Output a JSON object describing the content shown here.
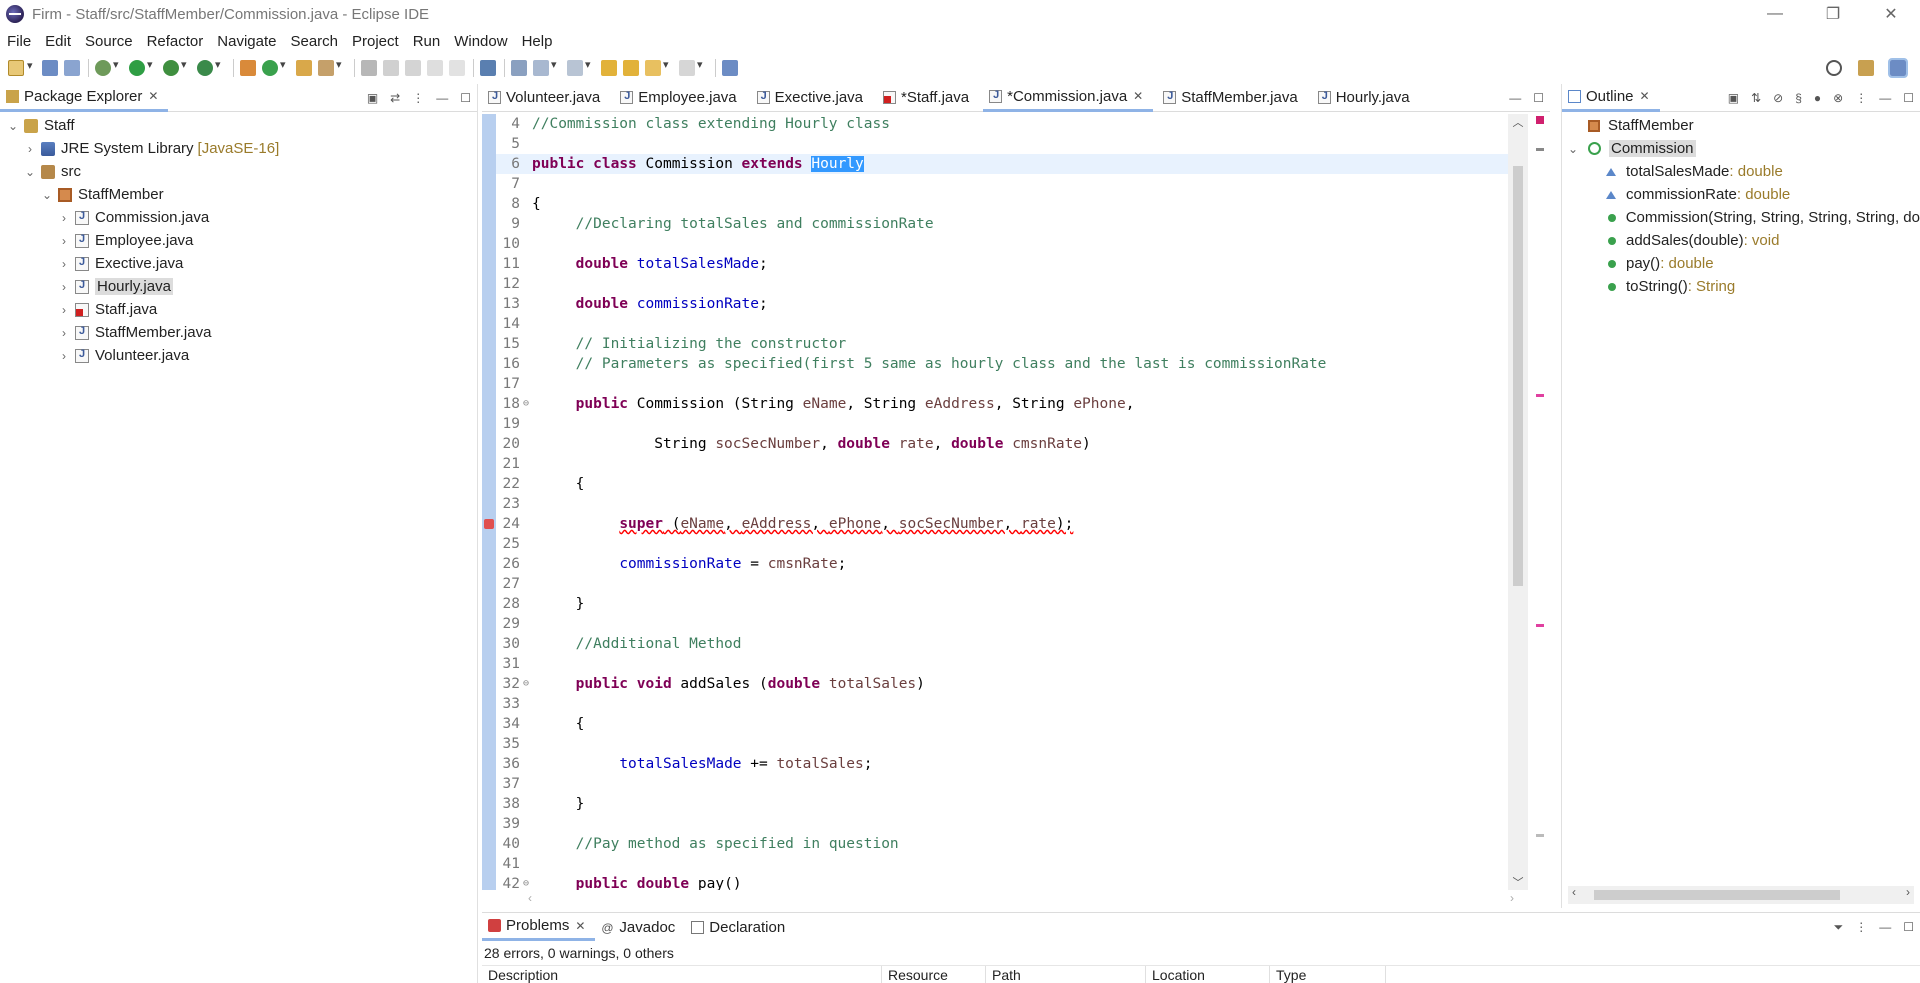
{
  "window": {
    "title": "Firm - Staff/src/StaffMember/Commission.java - Eclipse IDE",
    "controls": [
      "—",
      "❐",
      "✕"
    ]
  },
  "menu": [
    "File",
    "Edit",
    "Source",
    "Refactor",
    "Navigate",
    "Search",
    "Project",
    "Run",
    "Window",
    "Help"
  ],
  "package_explorer": {
    "tab_label": "Package Explorer",
    "tree": [
      {
        "label": "Staff",
        "twisty": "⌄",
        "indent": 0,
        "icon": "project-icon"
      },
      {
        "label": "JRE System Library",
        "decoration": "[JavaSE-16]",
        "twisty": "›",
        "indent": 1,
        "icon": "library-icon"
      },
      {
        "label": "src",
        "twisty": "⌄",
        "indent": 1,
        "icon": "source-folder-icon"
      },
      {
        "label": "StaffMember",
        "twisty": "⌄",
        "indent": 2,
        "icon": "package-icon"
      },
      {
        "label": "Commission.java",
        "twisty": "›",
        "indent": 3,
        "icon": "java-file-icon"
      },
      {
        "label": "Employee.java",
        "twisty": "›",
        "indent": 3,
        "icon": "java-file-icon"
      },
      {
        "label": "Exective.java",
        "twisty": "›",
        "indent": 3,
        "icon": "java-file-icon"
      },
      {
        "label": "Hourly.java",
        "twisty": "›",
        "indent": 3,
        "icon": "java-file-icon",
        "selected": true
      },
      {
        "label": "Staff.java",
        "twisty": "›",
        "indent": 3,
        "icon": "java-file-error-icon"
      },
      {
        "label": "StaffMember.java",
        "twisty": "›",
        "indent": 3,
        "icon": "java-file-icon"
      },
      {
        "label": "Volunteer.java",
        "twisty": "›",
        "indent": 3,
        "icon": "java-file-icon"
      }
    ]
  },
  "editor": {
    "tabs": [
      {
        "label": "Volunteer.java"
      },
      {
        "label": "Employee.java"
      },
      {
        "label": "Exective.java"
      },
      {
        "label": "*Staff.java",
        "error": true
      },
      {
        "label": "*Commission.java",
        "active": true
      },
      {
        "label": "StaffMember.java"
      },
      {
        "label": "Hourly.java"
      }
    ],
    "lines": [
      {
        "n": "4",
        "segs": [
          [
            "cm",
            "//Commission class extending Hourly class"
          ]
        ]
      },
      {
        "n": "5",
        "segs": []
      },
      {
        "n": "6",
        "hl": true,
        "segs": [
          [
            "kw",
            "public"
          ],
          [
            "",
            " "
          ],
          [
            "kw",
            "class"
          ],
          [
            "",
            " Commission "
          ],
          [
            "kw",
            "extends"
          ],
          [
            "",
            " "
          ],
          [
            "selw",
            "Hourly"
          ]
        ]
      },
      {
        "n": "7",
        "segs": []
      },
      {
        "n": "8",
        "segs": [
          [
            "",
            "{"
          ]
        ]
      },
      {
        "n": "9",
        "segs": [
          [
            "",
            "     "
          ],
          [
            "cm",
            "//Declaring totalSales and commissionRate"
          ]
        ]
      },
      {
        "n": "10",
        "segs": []
      },
      {
        "n": "11",
        "segs": [
          [
            "",
            "     "
          ],
          [
            "kw",
            "double"
          ],
          [
            "",
            " "
          ],
          [
            "fld",
            "totalSalesMade"
          ],
          [
            "",
            ";"
          ]
        ]
      },
      {
        "n": "12",
        "segs": []
      },
      {
        "n": "13",
        "segs": [
          [
            "",
            "     "
          ],
          [
            "kw",
            "double"
          ],
          [
            "",
            " "
          ],
          [
            "fld",
            "commissionRate"
          ],
          [
            "",
            ";"
          ]
        ]
      },
      {
        "n": "14",
        "segs": []
      },
      {
        "n": "15",
        "segs": [
          [
            "",
            "     "
          ],
          [
            "cm",
            "// Initializing the constructor"
          ]
        ]
      },
      {
        "n": "16",
        "segs": [
          [
            "",
            "     "
          ],
          [
            "cm",
            "// Parameters as specified(first 5 same as hourly class and the last is commissionRate"
          ]
        ]
      },
      {
        "n": "17",
        "segs": []
      },
      {
        "n": "18",
        "fold": "⊖",
        "segs": [
          [
            "",
            "     "
          ],
          [
            "kw",
            "public"
          ],
          [
            "",
            " Commission (String "
          ],
          [
            "par",
            "eName"
          ],
          [
            "",
            ", String "
          ],
          [
            "par",
            "eAddress"
          ],
          [
            "",
            ", String "
          ],
          [
            "par",
            "ePhone"
          ],
          [
            "",
            ","
          ]
        ]
      },
      {
        "n": "19",
        "segs": []
      },
      {
        "n": "20",
        "segs": [
          [
            "",
            "              String "
          ],
          [
            "par",
            "socSecNumber"
          ],
          [
            "",
            ", "
          ],
          [
            "kw",
            "double"
          ],
          [
            "",
            " "
          ],
          [
            "par",
            "rate"
          ],
          [
            "",
            ", "
          ],
          [
            "kw",
            "double"
          ],
          [
            "",
            " "
          ],
          [
            "par",
            "cmsnRate"
          ],
          [
            "",
            ")"
          ]
        ]
      },
      {
        "n": "21",
        "segs": []
      },
      {
        "n": "22",
        "segs": [
          [
            "",
            "     {"
          ]
        ]
      },
      {
        "n": "23",
        "segs": []
      },
      {
        "n": "24",
        "err": true,
        "segs": [
          [
            "",
            "          "
          ],
          [
            "kw err",
            "super"
          ],
          [
            "err",
            " ("
          ],
          [
            "par err",
            "eName"
          ],
          [
            "err",
            ", "
          ],
          [
            "par err",
            "eAddress"
          ],
          [
            "err",
            ", "
          ],
          [
            "par err",
            "ePhone"
          ],
          [
            "err",
            ", "
          ],
          [
            "par err",
            "socSecNumber"
          ],
          [
            "err",
            ", "
          ],
          [
            "par err",
            "rate"
          ],
          [
            "err",
            ");"
          ]
        ]
      },
      {
        "n": "25",
        "segs": []
      },
      {
        "n": "26",
        "segs": [
          [
            "",
            "          "
          ],
          [
            "fld",
            "commissionRate"
          ],
          [
            "",
            " = "
          ],
          [
            "par",
            "cmsnRate"
          ],
          [
            "",
            ";"
          ]
        ]
      },
      {
        "n": "27",
        "segs": []
      },
      {
        "n": "28",
        "segs": [
          [
            "",
            "     }"
          ]
        ]
      },
      {
        "n": "29",
        "segs": []
      },
      {
        "n": "30",
        "segs": [
          [
            "",
            "     "
          ],
          [
            "cm",
            "//Additional Method"
          ]
        ]
      },
      {
        "n": "31",
        "segs": []
      },
      {
        "n": "32",
        "fold": "⊖",
        "segs": [
          [
            "",
            "     "
          ],
          [
            "kw",
            "public"
          ],
          [
            "",
            " "
          ],
          [
            "kw",
            "void"
          ],
          [
            "",
            " addSales ("
          ],
          [
            "kw",
            "double"
          ],
          [
            "",
            " "
          ],
          [
            "par",
            "totalSales"
          ],
          [
            "",
            ")"
          ]
        ]
      },
      {
        "n": "33",
        "segs": []
      },
      {
        "n": "34",
        "segs": [
          [
            "",
            "     {"
          ]
        ]
      },
      {
        "n": "35",
        "segs": []
      },
      {
        "n": "36",
        "segs": [
          [
            "",
            "          "
          ],
          [
            "fld",
            "totalSalesMade"
          ],
          [
            "",
            " += "
          ],
          [
            "par",
            "totalSales"
          ],
          [
            "",
            ";"
          ]
        ]
      },
      {
        "n": "37",
        "segs": []
      },
      {
        "n": "38",
        "segs": [
          [
            "",
            "     }"
          ]
        ]
      },
      {
        "n": "39",
        "segs": []
      },
      {
        "n": "40",
        "segs": [
          [
            "",
            "     "
          ],
          [
            "cm",
            "//Pay method as specified in question"
          ]
        ]
      },
      {
        "n": "41",
        "segs": []
      },
      {
        "n": "42",
        "fold": "⊖",
        "segs": [
          [
            "",
            "     "
          ],
          [
            "kw",
            "public"
          ],
          [
            "",
            " "
          ],
          [
            "kw",
            "double"
          ],
          [
            "",
            " pay()"
          ]
        ]
      }
    ]
  },
  "outline": {
    "tab_label": "Outline",
    "items": [
      {
        "label": "StaffMember",
        "type": "",
        "kind": "package",
        "indent": 0
      },
      {
        "label": "Commission",
        "type": "",
        "kind": "class",
        "indent": 0,
        "selected": true
      },
      {
        "label": "totalSalesMade",
        "type": " : double",
        "kind": "field",
        "indent": 1
      },
      {
        "label": "commissionRate",
        "type": " : double",
        "kind": "field",
        "indent": 1
      },
      {
        "label": "Commission(String, String, String, String, do",
        "type": "",
        "kind": "constructor",
        "indent": 1
      },
      {
        "label": "addSales(double)",
        "type": " : void",
        "kind": "method",
        "indent": 1
      },
      {
        "label": "pay()",
        "type": " : double",
        "kind": "method",
        "indent": 1
      },
      {
        "label": "toString()",
        "type": " : String",
        "kind": "method",
        "indent": 1
      }
    ]
  },
  "problems": {
    "tabs": [
      "Problems",
      "Javadoc",
      "Declaration"
    ],
    "summary": "28 errors, 0 warnings, 0 others",
    "columns": [
      "Description",
      "Resource",
      "Path",
      "Location",
      "Type"
    ]
  }
}
